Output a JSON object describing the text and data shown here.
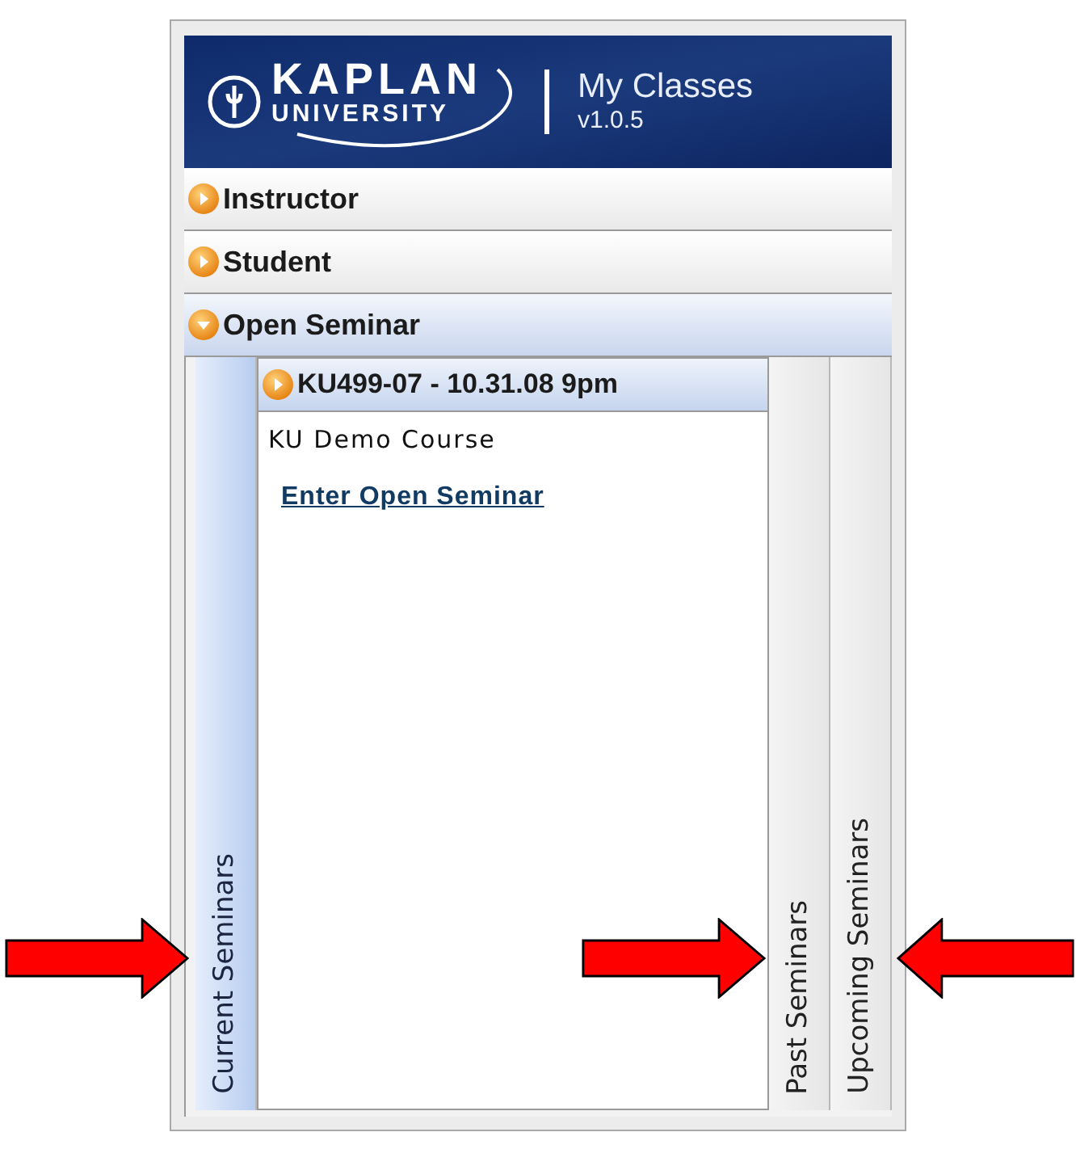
{
  "header": {
    "logo_line_1": "KAPLAN",
    "logo_line_2": "UNIVERSITY",
    "title": "My Classes",
    "version": "v1.0.5"
  },
  "sections": [
    {
      "label": "Instructor",
      "expanded": false
    },
    {
      "label": "Student",
      "expanded": false
    },
    {
      "label": "Open Seminar",
      "expanded": true
    }
  ],
  "seminar_tabs": [
    {
      "label": "Current Seminars",
      "selected": true
    },
    {
      "label": "Past Seminars",
      "selected": false
    },
    {
      "label": "Upcoming Seminars",
      "selected": false
    }
  ],
  "seminars": [
    {
      "title": "KU499-07 - 10.31.08 9pm",
      "course": "KU Demo Course",
      "link": "Enter Open Seminar"
    }
  ],
  "annotations": [
    {
      "kind": "arrow_right"
    },
    {
      "kind": "arrow_right"
    },
    {
      "kind": "arrow_left"
    }
  ]
}
